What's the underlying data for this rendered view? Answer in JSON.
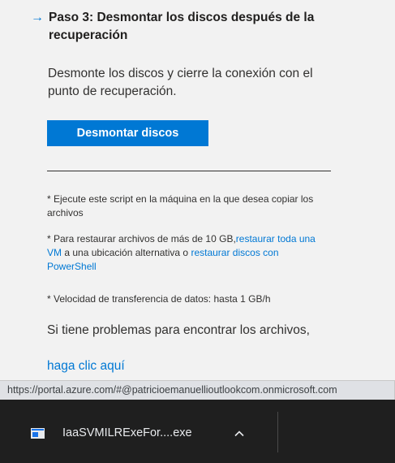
{
  "step": {
    "arrow_glyph": "→",
    "title": "Paso 3: Desmontar los discos después de la recuperación",
    "description": "Desmonte los discos y cierre la conexión con el punto de recuperación.",
    "button_label": "Desmontar discos"
  },
  "notes": {
    "note1": "* Ejecute este script en la máquina en la que desea copiar los archivos",
    "note2_prefix": "* Para restaurar archivos de más de 10 GB,",
    "note2_link1": "restaurar toda una VM",
    "note2_middle": " a una ubicación alternativa o ",
    "note2_link2": "restaurar discos con PowerShell",
    "note3": "* Velocidad de transferencia de datos: hasta 1 GB/h"
  },
  "help": {
    "text": "Si tiene problemas para encontrar los archivos,",
    "link": "haga clic aquí"
  },
  "statusbar": {
    "url": "https://portal.azure.com/#@patricioemanuellioutlookcom.onmicrosoft.com"
  },
  "download": {
    "file_name": "IaaSVMILRExeFor....exe",
    "icon": "window-app-icon",
    "menu_icon": "chevron-up-icon"
  },
  "colors": {
    "accent": "#0078d4",
    "shelf_bg": "#1f1f1f"
  }
}
